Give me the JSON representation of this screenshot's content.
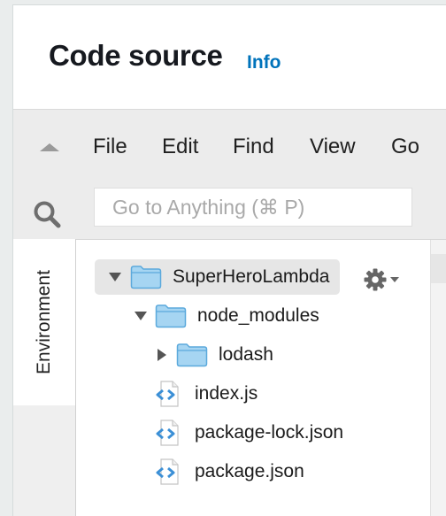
{
  "header": {
    "title": "Code source",
    "info_link": "Info"
  },
  "menubar": {
    "items": [
      {
        "label": "File"
      },
      {
        "label": "Edit"
      },
      {
        "label": "Find"
      },
      {
        "label": "View"
      },
      {
        "label": "Go"
      }
    ]
  },
  "search": {
    "placeholder": "Go to Anything (⌘ P)",
    "value": ""
  },
  "left_rail": {
    "environment_tab": "Environment"
  },
  "file_tree": {
    "items": [
      {
        "label": "SuperHeroLambda",
        "type": "folder",
        "expanded": true,
        "selected": true,
        "depth": 0
      },
      {
        "label": "node_modules",
        "type": "folder",
        "expanded": true,
        "selected": false,
        "depth": 1
      },
      {
        "label": "lodash",
        "type": "folder",
        "expanded": false,
        "selected": false,
        "depth": 2
      },
      {
        "label": "index.js",
        "type": "file",
        "selected": false,
        "depth": 1
      },
      {
        "label": "package-lock.json",
        "type": "file",
        "selected": false,
        "depth": 1
      },
      {
        "label": "package.json",
        "type": "file",
        "selected": false,
        "depth": 1
      }
    ]
  },
  "icons": {
    "collapse": "chevron-up-icon",
    "search": "search-icon",
    "folder": "folder-icon",
    "file": "code-file-icon",
    "settings": "gear-icon"
  },
  "colors": {
    "link": "#0073bb",
    "folder_fill": "#a6d5f2",
    "folder_stroke": "#5ba9dc",
    "file_code": "#3b8fd6",
    "selected_row": "#e6e6e6"
  }
}
